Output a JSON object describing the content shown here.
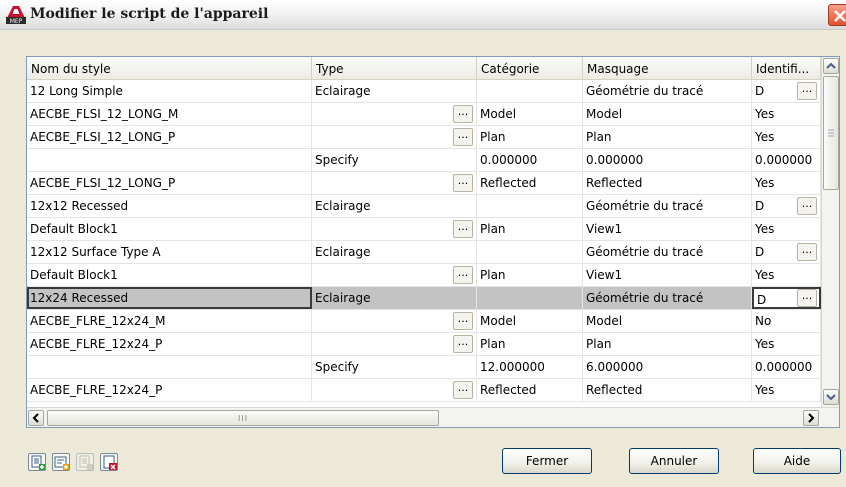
{
  "window": {
    "title": "Modifier le script de l'appareil",
    "app_icon": "autocad-mep-icon",
    "close_icon": "close-icon"
  },
  "grid": {
    "columns": [
      "Nom du style",
      "Type",
      "Catégorie",
      "Masquage",
      "Identifi..."
    ],
    "rows": [
      {
        "c0": "12 Long Simple",
        "c1": "Eclairage",
        "c2": "",
        "c3": "Géométrie du tracé",
        "c4": "D"
      },
      {
        "c0": "AECBE_FLSI_12_LONG_M",
        "c1": "",
        "c2": "Model",
        "c3": "Model",
        "c4": "Yes"
      },
      {
        "c0": "AECBE_FLSI_12_LONG_P",
        "c1": "",
        "c2": "Plan",
        "c3": "Plan",
        "c4": "Yes"
      },
      {
        "c0": "",
        "c1": "Specify",
        "c2": "0.000000",
        "c3": "0.000000",
        "c4": "0.000000"
      },
      {
        "c0": "AECBE_FLSI_12_LONG_P",
        "c1": "",
        "c2": "Reflected",
        "c3": "Reflected",
        "c4": "Yes"
      },
      {
        "c0": "12x12 Recessed",
        "c1": "Eclairage",
        "c2": "",
        "c3": "Géométrie du tracé",
        "c4": "D"
      },
      {
        "c0": "Default Block1",
        "c1": "",
        "c2": "Plan",
        "c3": "View1",
        "c4": "Yes"
      },
      {
        "c0": "12x12 Surface Type A",
        "c1": "Eclairage",
        "c2": "",
        "c3": "Géométrie du tracé",
        "c4": "D"
      },
      {
        "c0": "Default Block1",
        "c1": "",
        "c2": "Plan",
        "c3": "View1",
        "c4": "Yes"
      },
      {
        "c0": "12x24 Recessed",
        "c1": "Eclairage",
        "c2": "",
        "c3": "Géométrie du tracé",
        "c4": "D"
      },
      {
        "c0": "AECBE_FLRE_12x24_M",
        "c1": "",
        "c2": "Model",
        "c3": "Model",
        "c4": "No"
      },
      {
        "c0": "AECBE_FLRE_12x24_P",
        "c1": "",
        "c2": "Plan",
        "c3": "Plan",
        "c4": "Yes"
      },
      {
        "c0": "",
        "c1": "Specify",
        "c2": "12.000000",
        "c3": "6.000000",
        "c4": "0.000000"
      },
      {
        "c0": "AECBE_FLRE_12x24_P",
        "c1": "",
        "c2": "Reflected",
        "c3": "Reflected",
        "c4": "Yes"
      }
    ],
    "ellipsis_label": "...",
    "selected_row": "12x24 Recessed",
    "hscroll_grip": "III"
  },
  "toolbar": {
    "icons": [
      "add-style-icon",
      "add-block-icon",
      "add-item-disabled-icon",
      "delete-icon"
    ]
  },
  "buttons": {
    "close": "Fermer",
    "cancel": "Annuler",
    "help": "Aide"
  },
  "colors": {
    "dialog_bg": "#ece9d8",
    "selected_row": "#c3c3c3",
    "close_button": "#e2512f"
  }
}
